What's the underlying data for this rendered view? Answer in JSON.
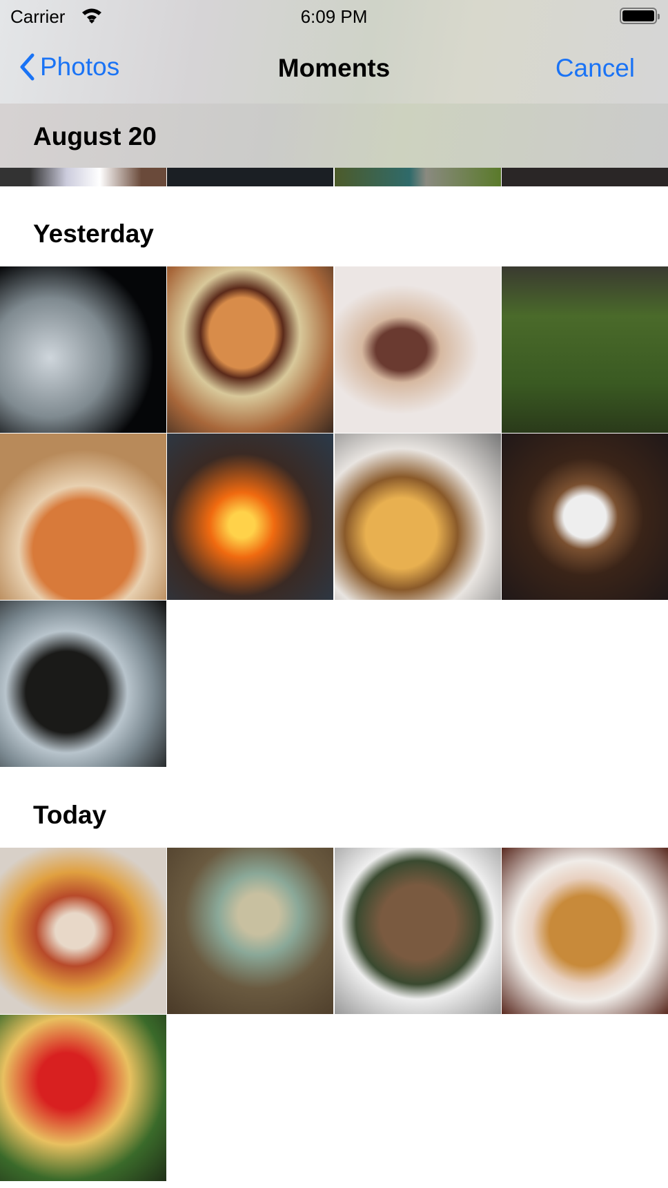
{
  "status_bar": {
    "carrier": "Carrier",
    "time": "6:09 PM"
  },
  "nav": {
    "back_label": "Photos",
    "title": "Moments",
    "cancel_label": "Cancel"
  },
  "sections": [
    {
      "header": "August 20",
      "photos": [
        "bridge",
        "dark-night",
        "aerial-coast",
        "dark-forest"
      ]
    },
    {
      "header": "Yesterday",
      "photos": [
        "gin-tonic",
        "burger-basket",
        "chocolate-drink",
        "grill-tripod",
        "pizza",
        "campfire",
        "burger-fries",
        "plated-dish",
        "noodle-bowl"
      ]
    },
    {
      "header": "Today",
      "photos": [
        "nachos",
        "pho-bowl",
        "ramen-eggs",
        "ramen-bowl",
        "tomatoes-pasta"
      ]
    }
  ],
  "colors": {
    "accent": "#1a73f5"
  }
}
